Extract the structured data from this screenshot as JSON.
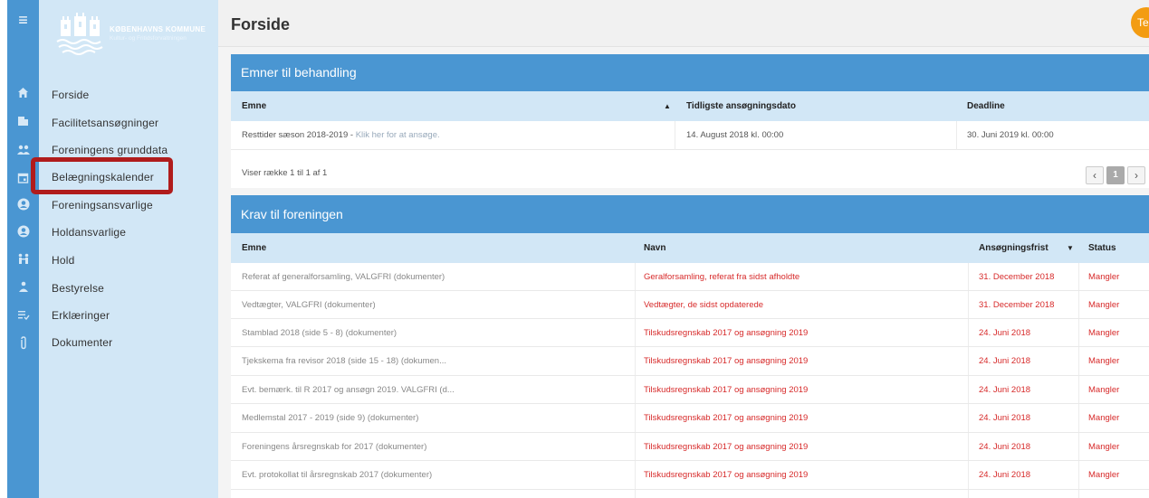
{
  "sidebar": {
    "menu_icon": "≡",
    "logo": {
      "line1": "KØBENHAVNS KOMMUNE",
      "line2": "Kultur- og Fritidsforvaltningen"
    },
    "items": [
      {
        "label": "Forside",
        "icon": "home-icon"
      },
      {
        "label": "Facilitetsansøgninger",
        "icon": "building-icon"
      },
      {
        "label": "Foreningens grunddata",
        "icon": "users-icon"
      },
      {
        "label": "Belægningskalender",
        "icon": "calendar-icon"
      },
      {
        "label": "Foreningsansvarlige",
        "icon": "user-circle-icon"
      },
      {
        "label": "Holdansvarlige",
        "icon": "user-circle-icon"
      },
      {
        "label": "Hold",
        "icon": "group-icon"
      },
      {
        "label": "Bestyrelse",
        "icon": "board-icon"
      },
      {
        "label": "Erklæringer",
        "icon": "checklist-icon"
      },
      {
        "label": "Dokumenter",
        "icon": "paperclip-icon"
      }
    ]
  },
  "header": {
    "title": "Forside",
    "avatar_initials": "Te"
  },
  "panel1": {
    "title": "Emner til behandling",
    "columns": {
      "emne": "Emne",
      "tidligste": "Tidligste ansøgningsdato",
      "deadline": "Deadline"
    },
    "sort_icon": "▲",
    "row": {
      "emne": "Resttider sæson 2018-2019 - ",
      "link": "Klik her for at ansøge.",
      "tidligste": "14. August 2018 kl. 00:00",
      "deadline": "30. Juni 2019 kl. 00:00"
    },
    "footer": "Viser række 1 til 1 af 1",
    "pager": {
      "prev": "‹",
      "page": "1",
      "next": "›"
    }
  },
  "panel2": {
    "title": "Krav til foreningen",
    "columns": {
      "emne": "Emne",
      "navn": "Navn",
      "frist": "Ansøgningsfrist",
      "status": "Status"
    },
    "sort_icon": "▼",
    "rows": [
      {
        "emne": "Referat af generalforsamling, VALGFRI (dokumenter)",
        "navn": "Geralforsamling, referat fra sidst afholdte",
        "frist": "31. December 2018",
        "status": "Mangler"
      },
      {
        "emne": "Vedtægter, VALGFRI (dokumenter)",
        "navn": "Vedtægter, de sidst opdaterede",
        "frist": "31. December 2018",
        "status": "Mangler"
      },
      {
        "emne": "Stamblad 2018 (side 5 - 8) (dokumenter)",
        "navn": "Tilskudsregnskab 2017 og ansøgning 2019",
        "frist": "24. Juni 2018",
        "status": "Mangler"
      },
      {
        "emne": "Tjekskema fra revisor 2018 (side 15 - 18) (dokumen...",
        "navn": "Tilskudsregnskab 2017 og ansøgning 2019",
        "frist": "24. Juni 2018",
        "status": "Mangler"
      },
      {
        "emne": "Evt. bemærk. til R 2017 og ansøgn 2019. VALGFRI (d...",
        "navn": "Tilskudsregnskab 2017 og ansøgning 2019",
        "frist": "24. Juni 2018",
        "status": "Mangler"
      },
      {
        "emne": "Medlemstal 2017 - 2019 (side 9) (dokumenter)",
        "navn": "Tilskudsregnskab 2017 og ansøgning 2019",
        "frist": "24. Juni 2018",
        "status": "Mangler"
      },
      {
        "emne": "Foreningens årsregnskab for 2017 (dokumenter)",
        "navn": "Tilskudsregnskab 2017 og ansøgning 2019",
        "frist": "24. Juni 2018",
        "status": "Mangler"
      },
      {
        "emne": "Evt. protokollat til årsregnskab 2017 (dokumenter)",
        "navn": "Tilskudsregnskab 2017 og ansøgning 2019",
        "frist": "24. Juni 2018",
        "status": "Mangler"
      }
    ]
  },
  "colors": {
    "primary": "#4a96d2",
    "sidebar": "#d2e7f6",
    "highlight": "#b01c1c",
    "status_red": "#d72a2a",
    "avatar": "#f39c12"
  }
}
